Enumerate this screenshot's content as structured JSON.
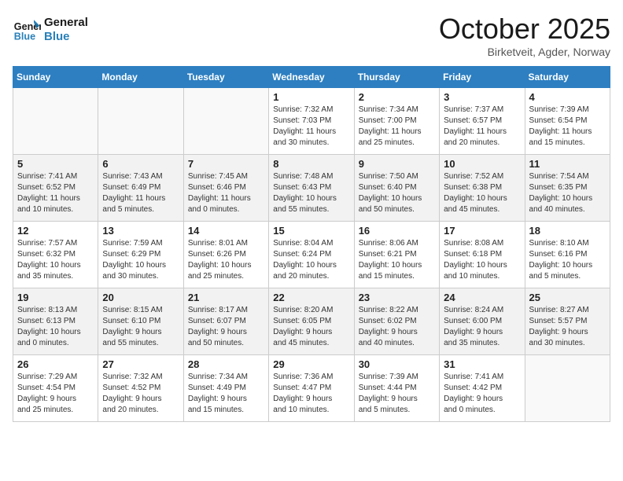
{
  "logo": {
    "line1": "General",
    "line2": "Blue"
  },
  "title": "October 2025",
  "location": "Birketveit, Agder, Norway",
  "headers": [
    "Sunday",
    "Monday",
    "Tuesday",
    "Wednesday",
    "Thursday",
    "Friday",
    "Saturday"
  ],
  "rows": [
    [
      {
        "day": "",
        "detail": ""
      },
      {
        "day": "",
        "detail": ""
      },
      {
        "day": "",
        "detail": ""
      },
      {
        "day": "1",
        "detail": "Sunrise: 7:32 AM\nSunset: 7:03 PM\nDaylight: 11 hours\nand 30 minutes."
      },
      {
        "day": "2",
        "detail": "Sunrise: 7:34 AM\nSunset: 7:00 PM\nDaylight: 11 hours\nand 25 minutes."
      },
      {
        "day": "3",
        "detail": "Sunrise: 7:37 AM\nSunset: 6:57 PM\nDaylight: 11 hours\nand 20 minutes."
      },
      {
        "day": "4",
        "detail": "Sunrise: 7:39 AM\nSunset: 6:54 PM\nDaylight: 11 hours\nand 15 minutes."
      }
    ],
    [
      {
        "day": "5",
        "detail": "Sunrise: 7:41 AM\nSunset: 6:52 PM\nDaylight: 11 hours\nand 10 minutes."
      },
      {
        "day": "6",
        "detail": "Sunrise: 7:43 AM\nSunset: 6:49 PM\nDaylight: 11 hours\nand 5 minutes."
      },
      {
        "day": "7",
        "detail": "Sunrise: 7:45 AM\nSunset: 6:46 PM\nDaylight: 11 hours\nand 0 minutes."
      },
      {
        "day": "8",
        "detail": "Sunrise: 7:48 AM\nSunset: 6:43 PM\nDaylight: 10 hours\nand 55 minutes."
      },
      {
        "day": "9",
        "detail": "Sunrise: 7:50 AM\nSunset: 6:40 PM\nDaylight: 10 hours\nand 50 minutes."
      },
      {
        "day": "10",
        "detail": "Sunrise: 7:52 AM\nSunset: 6:38 PM\nDaylight: 10 hours\nand 45 minutes."
      },
      {
        "day": "11",
        "detail": "Sunrise: 7:54 AM\nSunset: 6:35 PM\nDaylight: 10 hours\nand 40 minutes."
      }
    ],
    [
      {
        "day": "12",
        "detail": "Sunrise: 7:57 AM\nSunset: 6:32 PM\nDaylight: 10 hours\nand 35 minutes."
      },
      {
        "day": "13",
        "detail": "Sunrise: 7:59 AM\nSunset: 6:29 PM\nDaylight: 10 hours\nand 30 minutes."
      },
      {
        "day": "14",
        "detail": "Sunrise: 8:01 AM\nSunset: 6:26 PM\nDaylight: 10 hours\nand 25 minutes."
      },
      {
        "day": "15",
        "detail": "Sunrise: 8:04 AM\nSunset: 6:24 PM\nDaylight: 10 hours\nand 20 minutes."
      },
      {
        "day": "16",
        "detail": "Sunrise: 8:06 AM\nSunset: 6:21 PM\nDaylight: 10 hours\nand 15 minutes."
      },
      {
        "day": "17",
        "detail": "Sunrise: 8:08 AM\nSunset: 6:18 PM\nDaylight: 10 hours\nand 10 minutes."
      },
      {
        "day": "18",
        "detail": "Sunrise: 8:10 AM\nSunset: 6:16 PM\nDaylight: 10 hours\nand 5 minutes."
      }
    ],
    [
      {
        "day": "19",
        "detail": "Sunrise: 8:13 AM\nSunset: 6:13 PM\nDaylight: 10 hours\nand 0 minutes."
      },
      {
        "day": "20",
        "detail": "Sunrise: 8:15 AM\nSunset: 6:10 PM\nDaylight: 9 hours\nand 55 minutes."
      },
      {
        "day": "21",
        "detail": "Sunrise: 8:17 AM\nSunset: 6:07 PM\nDaylight: 9 hours\nand 50 minutes."
      },
      {
        "day": "22",
        "detail": "Sunrise: 8:20 AM\nSunset: 6:05 PM\nDaylight: 9 hours\nand 45 minutes."
      },
      {
        "day": "23",
        "detail": "Sunrise: 8:22 AM\nSunset: 6:02 PM\nDaylight: 9 hours\nand 40 minutes."
      },
      {
        "day": "24",
        "detail": "Sunrise: 8:24 AM\nSunset: 6:00 PM\nDaylight: 9 hours\nand 35 minutes."
      },
      {
        "day": "25",
        "detail": "Sunrise: 8:27 AM\nSunset: 5:57 PM\nDaylight: 9 hours\nand 30 minutes."
      }
    ],
    [
      {
        "day": "26",
        "detail": "Sunrise: 7:29 AM\nSunset: 4:54 PM\nDaylight: 9 hours\nand 25 minutes."
      },
      {
        "day": "27",
        "detail": "Sunrise: 7:32 AM\nSunset: 4:52 PM\nDaylight: 9 hours\nand 20 minutes."
      },
      {
        "day": "28",
        "detail": "Sunrise: 7:34 AM\nSunset: 4:49 PM\nDaylight: 9 hours\nand 15 minutes."
      },
      {
        "day": "29",
        "detail": "Sunrise: 7:36 AM\nSunset: 4:47 PM\nDaylight: 9 hours\nand 10 minutes."
      },
      {
        "day": "30",
        "detail": "Sunrise: 7:39 AM\nSunset: 4:44 PM\nDaylight: 9 hours\nand 5 minutes."
      },
      {
        "day": "31",
        "detail": "Sunrise: 7:41 AM\nSunset: 4:42 PM\nDaylight: 9 hours\nand 0 minutes."
      },
      {
        "day": "",
        "detail": ""
      }
    ]
  ]
}
